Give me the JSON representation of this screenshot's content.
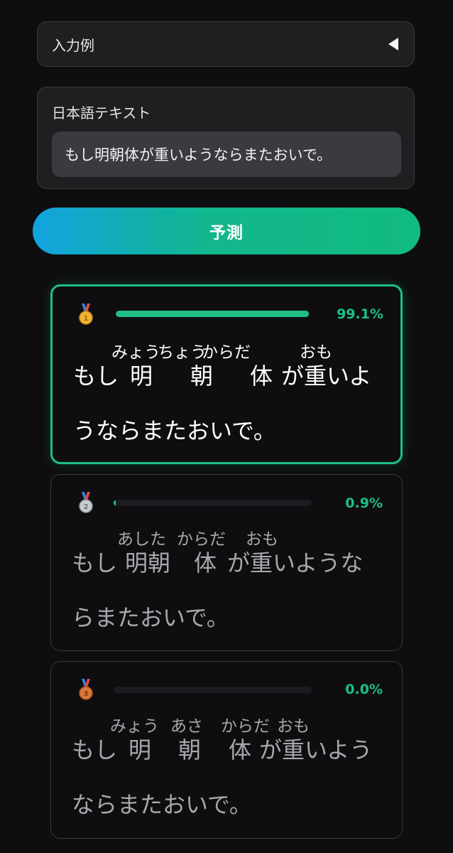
{
  "examples_label": "入力例",
  "input": {
    "label": "日本語テキスト",
    "value": "もし明朝体が重いようならまたおいで。"
  },
  "predict_label": "予測",
  "results": [
    {
      "rank": 1,
      "medal": "gold-medal-icon",
      "percent": "99.1%",
      "score": 0.991,
      "ruby": [
        "みょう",
        "ちょう",
        "からだ",
        "おも"
      ],
      "line1": [
        "もし",
        "明",
        "朝",
        "体",
        "が重いよ"
      ],
      "line2": "うならまたおいで。"
    },
    {
      "rank": 2,
      "medal": "silver-medal-icon",
      "percent": "0.9%",
      "score": 0.009,
      "ruby": [
        "あした",
        "からだ",
        "おも"
      ],
      "line1": [
        "もし",
        "明朝",
        "体",
        "が重いような"
      ],
      "line2": "らまたおいで。"
    },
    {
      "rank": 3,
      "medal": "bronze-medal-icon",
      "percent": "0.0%",
      "score": 0.0,
      "ruby": [
        "みょう",
        "あさ",
        "からだ",
        "おも"
      ],
      "line1": [
        "もし",
        "明",
        "朝",
        "体",
        "が重いよう"
      ],
      "line2": "ならまたおいで。"
    }
  ],
  "colors": {
    "accent": "#1fbf86",
    "gradient_start": "#12a3e0",
    "gradient_end": "#12bb80",
    "gold": "#f2b233",
    "silver": "#c9ccd1",
    "bronze": "#d9793a",
    "ribbon": "#3b7fd6"
  }
}
